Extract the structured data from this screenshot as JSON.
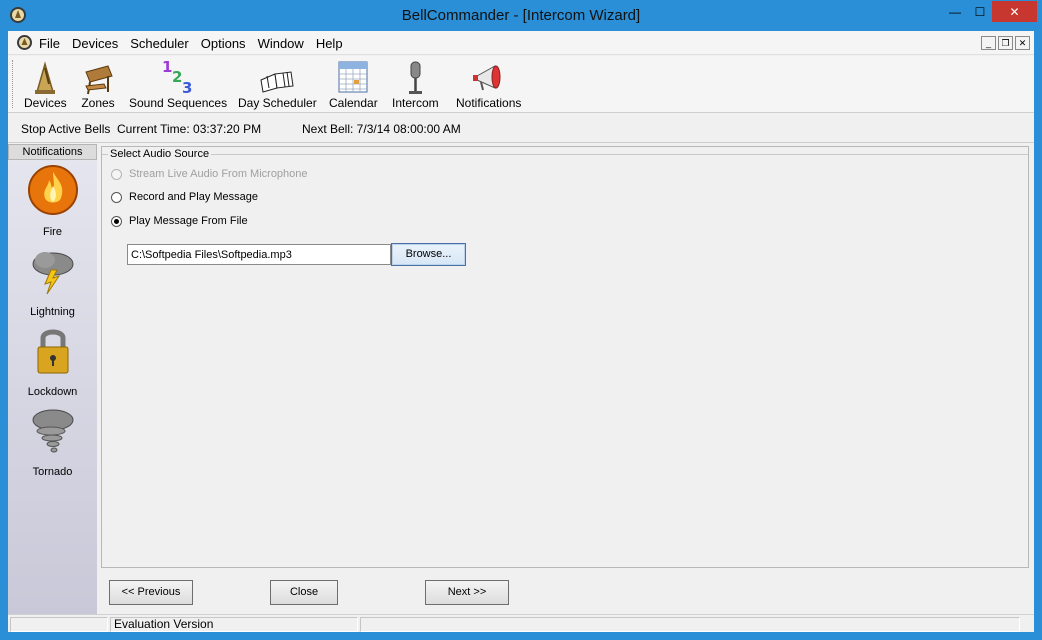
{
  "window": {
    "title": "BellCommander - [Intercom Wizard]",
    "controls": {
      "minimize": "—",
      "maximize": "☐",
      "close": "✕"
    },
    "colors": {
      "titlebar": "#2a8fd6",
      "close": "#c7372f"
    }
  },
  "menubar": {
    "items": [
      "File",
      "Devices",
      "Scheduler",
      "Options",
      "Window",
      "Help"
    ],
    "mdi_controls": {
      "minimize": "_",
      "restore": "❐",
      "close": "✕"
    }
  },
  "toolbar": {
    "items": [
      {
        "label": "Devices",
        "icon": "devices-icon"
      },
      {
        "label": "Zones",
        "icon": "zones-icon"
      },
      {
        "label": "Sound Sequences",
        "icon": "sound-sequences-icon"
      },
      {
        "label": "Day Scheduler",
        "icon": "day-scheduler-icon"
      },
      {
        "label": "Calendar",
        "icon": "calendar-icon"
      },
      {
        "label": "Intercom",
        "icon": "intercom-icon"
      },
      {
        "label": "Notifications",
        "icon": "notifications-icon"
      }
    ]
  },
  "statusline": {
    "stop_label": "Stop Active Bells",
    "current_time": "Current Time: 03:37:20 PM",
    "next_bell": "Next Bell: 7/3/14 08:00:00 AM"
  },
  "sidebar": {
    "header": "Notifications",
    "items": [
      {
        "label": "Fire",
        "icon": "fire-icon"
      },
      {
        "label": "Lightning",
        "icon": "lightning-icon"
      },
      {
        "label": "Lockdown",
        "icon": "lock-icon"
      },
      {
        "label": "Tornado",
        "icon": "tornado-icon"
      }
    ]
  },
  "audio_source": {
    "group_label": "Select Audio Source",
    "options": [
      {
        "label": "Stream Live Audio From Microphone",
        "enabled": false,
        "selected": false
      },
      {
        "label": "Record and Play Message",
        "enabled": true,
        "selected": false
      },
      {
        "label": "Play Message From File",
        "enabled": true,
        "selected": true
      }
    ],
    "file_path": "C:\\Softpedia Files\\Softpedia.mp3",
    "browse_label": "Browse..."
  },
  "wizard_buttons": {
    "previous": "<< Previous",
    "close": "Close",
    "next": "Next >>"
  },
  "statusbar": {
    "panes": [
      "",
      "Evaluation Version",
      ""
    ]
  }
}
